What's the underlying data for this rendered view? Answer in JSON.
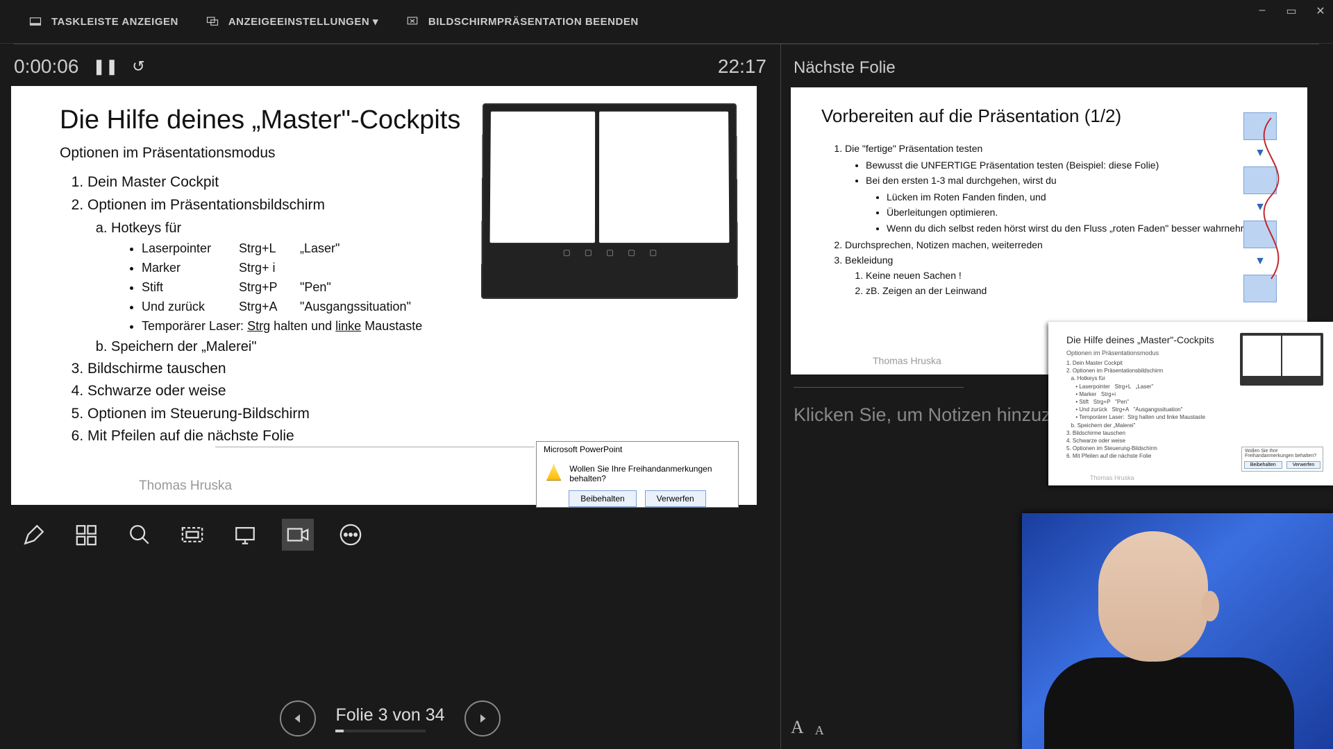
{
  "window": {
    "minimize": "–",
    "maximize": "▭",
    "close": "✕"
  },
  "topbar": {
    "show_taskbar": "TASKLEISTE ANZEIGEN",
    "display_settings": "ANZEIGEEINSTELLUNGEN ▾",
    "end_show": "BILDSCHIRMPRÄSENTATION BEENDEN"
  },
  "time": {
    "elapsed": "0:00:06",
    "pause": "❚❚",
    "reset": "↺",
    "clock": "22:17"
  },
  "slide": {
    "title": "Die Hilfe deines „Master\"-Cockpits",
    "subtitle": "Optionen im Präsentationsmodus",
    "items": [
      "Dein Master Cockpit",
      "Optionen im Präsentationsbildschirm",
      "Bildschirme tauschen",
      "Schwarze oder weise",
      "Optionen im Steuerung-Bildschirm",
      "Mit Pfeilen auf die nächste Folie"
    ],
    "sub_a": "Hotkeys für",
    "hk": [
      {
        "name": "Laserpointer",
        "key": "Strg+L",
        "label": "„Laser\""
      },
      {
        "name": "Marker",
        "key": "Strg+ i",
        "label": ""
      },
      {
        "name": "Stift",
        "key": "Strg+P",
        "label": "\"Pen\""
      },
      {
        "name": "Und zurück",
        "key": "Strg+A",
        "label": "\"Ausgangssituation\""
      }
    ],
    "hk_extra_pre": "Temporärer Laser:  ",
    "hk_extra_u1": "Strg",
    "hk_extra_mid": " halten und ",
    "hk_extra_u2": "linke",
    "hk_extra_post": " Maustaste",
    "sub_b": "Speichern der „Malerei\"",
    "author": "Thomas Hruska"
  },
  "dialog": {
    "title": "Microsoft PowerPoint",
    "msg": "Wollen Sie Ihre Freihandanmerkungen behalten?",
    "keep": "Beibehalten",
    "discard": "Verwerfen"
  },
  "tools": [
    "pen-icon",
    "slideshow-icon",
    "zoom-icon",
    "laser-icon",
    "blackout-icon",
    "camera-icon",
    "more-icon"
  ],
  "nav": {
    "label": "Folie 3 von 34"
  },
  "right": {
    "heading": "Nächste Folie",
    "notes_placeholder": "Klicken Sie, um Notizen hinzuzufüge"
  },
  "next": {
    "title": "Vorbereiten auf die Präsentation (1/2)",
    "i1": "Die \"fertige\" Präsentation testen",
    "i1a": "Bewusst die UNFERTIGE Präsentation testen (Beispiel: diese Folie)",
    "i1b": "Bei den ersten 1-3 mal durchgehen, wirst du",
    "i1b1": "Lücken im Roten Fanden finden, und",
    "i1b2": "Überleitungen optimieren.",
    "i1b3": "Wenn du dich selbst reden hörst wirst du den Fluss „roten Faden\" besser wahrnehmen",
    "i2": "Durchsprechen, Notizen machen, weiterreden",
    "i3": "Bekleidung",
    "i3a": "Keine neuen Sachen !",
    "i3b": "zB. Zeigen an der Leinwand",
    "author": "Thomas Hruska"
  },
  "inset": {
    "title": "Die Hilfe deines „Master\"-Cockpits",
    "sub": "Optionen im Präsentationsmodus",
    "lines": [
      "1. Dein Master Cockpit",
      "2. Optionen im Präsentationsbildschirm",
      "   a. Hotkeys für",
      "      • Laserpointer   Strg+L   „Laser\"",
      "      • Marker   Strg+i",
      "      • Stift   Strg+P   \"Pen\"",
      "      • Und zurück   Strg+A   \"Ausgangssituation\"",
      "      • Temporärer Laser:  Strg halten und linke Maustaste",
      "   b. Speichern der „Malerei\"",
      "3. Bildschirme tauschen",
      "4. Schwarze oder weise",
      "5. Optionen im Steuerung-Bildschirm",
      "6. Mit Pfeilen auf die nächste Folie"
    ],
    "author": "Thomas Hruska",
    "dlg": "Wollen Sie Ihre Freihandanmerkungen behalten?",
    "keep": "Beibehalten",
    "discard": "Verwerfen"
  }
}
